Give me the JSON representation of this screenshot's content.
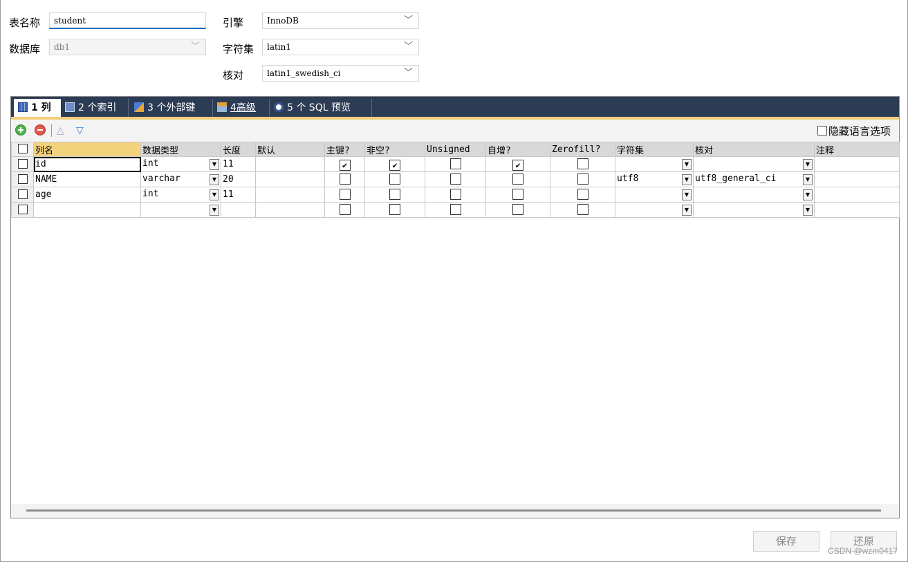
{
  "form": {
    "table_name_label": "表名称",
    "table_name_value": "student",
    "database_label": "数据库",
    "database_value": "db1",
    "engine_label": "引擎",
    "engine_value": "InnoDB",
    "charset_label": "字符集",
    "charset_value": "latin1",
    "collation_label": "核对",
    "collation_value": "latin1_swedish_ci"
  },
  "tabs": [
    {
      "label": "1 列",
      "icon": "columns-icon"
    },
    {
      "label": "2 个索引",
      "icon": "index-icon"
    },
    {
      "label": "3 个外部键",
      "icon": "foreign-key-icon"
    },
    {
      "label": "4高级",
      "icon": "advanced-icon"
    },
    {
      "label": "5 个 SQL 预览",
      "icon": "sql-preview-icon"
    }
  ],
  "toolbar": {
    "hide_language_label": "隐藏语言选项"
  },
  "grid": {
    "columns": [
      "列名",
      "数据类型",
      "长度",
      "默认",
      "主键?",
      "非空?",
      "Unsigned",
      "自增?",
      "Zerofill?",
      "字符集",
      "核对",
      "注释"
    ],
    "rows": [
      {
        "name": "id",
        "type": "int",
        "length": "11",
        "default": "",
        "pk": true,
        "not_null": true,
        "unsigned": false,
        "auto_inc": true,
        "zerofill": false,
        "charset": "",
        "collation": "",
        "comment": ""
      },
      {
        "name": "NAME",
        "type": "varchar",
        "length": "20",
        "default": "",
        "pk": false,
        "not_null": false,
        "unsigned": false,
        "auto_inc": false,
        "zerofill": false,
        "charset": "utf8",
        "collation": "utf8_general_ci",
        "comment": ""
      },
      {
        "name": "age",
        "type": "int",
        "length": "11",
        "default": "",
        "pk": false,
        "not_null": false,
        "unsigned": false,
        "auto_inc": false,
        "zerofill": false,
        "charset": "",
        "collation": "",
        "comment": ""
      },
      {
        "name": "",
        "type": "",
        "length": "",
        "default": "",
        "pk": false,
        "not_null": false,
        "unsigned": false,
        "auto_inc": false,
        "zerofill": false,
        "charset": "",
        "collation": "",
        "comment": ""
      }
    ]
  },
  "buttons": {
    "save_label": "保存",
    "revert_label": "还原"
  },
  "watermark": "CSDN @wzm0417",
  "colors": {
    "tabbar_bg": "#2d3c55",
    "accent_gold": "#f2ce7a",
    "focus_underline": "#1e6cc0"
  }
}
